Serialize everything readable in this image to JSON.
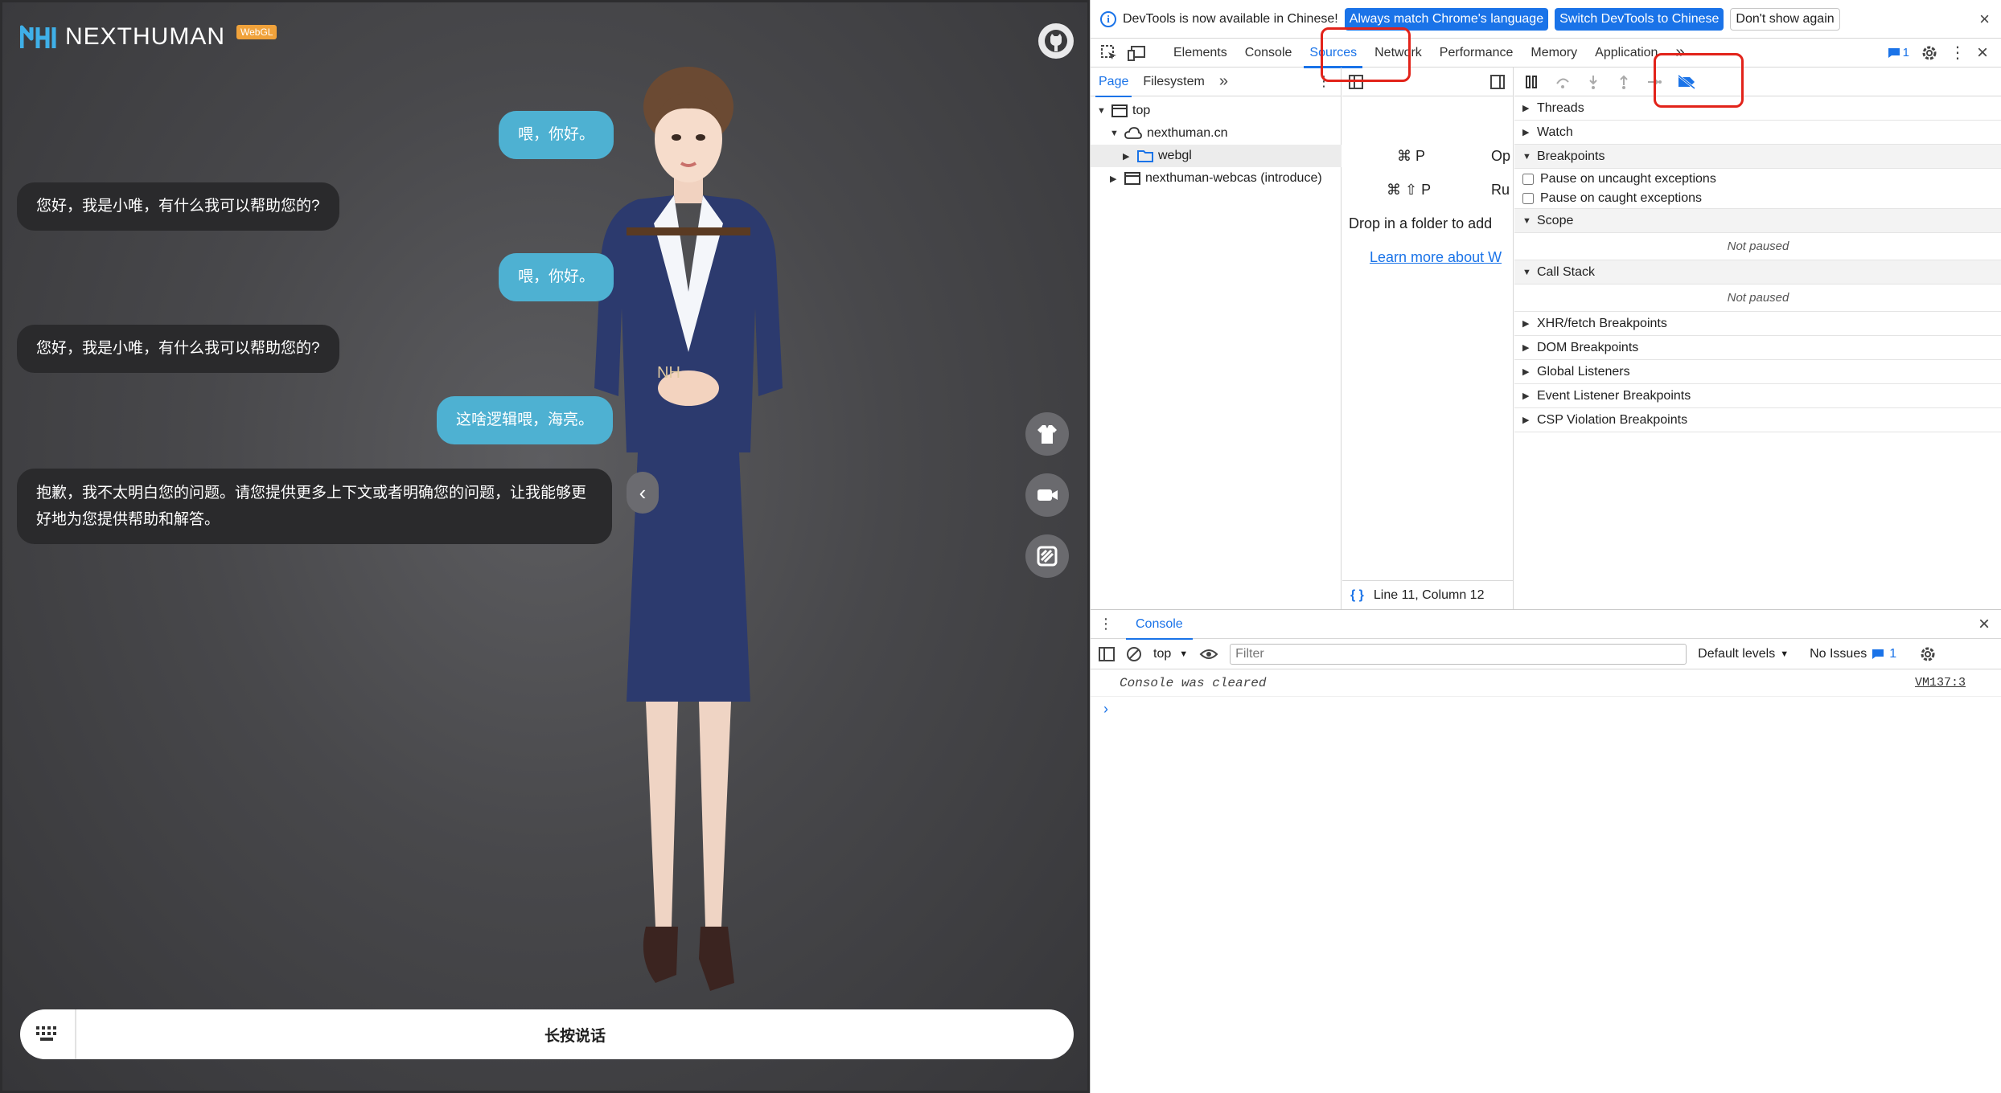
{
  "app": {
    "logo_text": "NEXTHUMAN",
    "logo_badge": "WebGL",
    "messages": [
      {
        "role": "user",
        "text": "喂，你好。"
      },
      {
        "role": "bot",
        "text": "您好，我是小唯，有什么我可以帮助您的?"
      },
      {
        "role": "user",
        "text": "喂，你好。"
      },
      {
        "role": "bot",
        "text": "您好，我是小唯，有什么我可以帮助您的?"
      },
      {
        "role": "user",
        "text": "这啥逻辑喂，海亮。"
      },
      {
        "role": "bot",
        "text": "抱歉，我不太明白您的问题。请您提供更多上下文或者明确您的问题，让我能够更好地为您提供帮助和解答。"
      }
    ],
    "belt_text": "NH",
    "hold_to_talk": "长按说话"
  },
  "devtools": {
    "infobar": {
      "text": "DevTools is now available in Chinese!",
      "btn_match": "Always match Chrome's language",
      "btn_switch": "Switch DevTools to Chinese",
      "btn_dont": "Don't show again"
    },
    "tabs": [
      "Elements",
      "Console",
      "Sources",
      "Network",
      "Performance",
      "Memory",
      "Application"
    ],
    "active_tab": "Sources",
    "issues_count": "1",
    "navigator": {
      "tabs": [
        "Page",
        "Filesystem"
      ],
      "tree": [
        "top",
        "nexthuman.cn",
        "webgl",
        "nexthuman-webcas (introduce)"
      ]
    },
    "editor": {
      "shortcut1_keys": "⌘ P",
      "shortcut1_label": "Op",
      "shortcut2_keys": "⌘ ⇧ P",
      "shortcut2_label": "Ru",
      "drop_text": "Drop in a folder to add",
      "learn_more": "Learn more about W",
      "cursor": "Line 11, Column 12"
    },
    "debugger": {
      "threads": "Threads",
      "watch": "Watch",
      "breakpoints": "Breakpoints",
      "pause_uncaught": "Pause on uncaught exceptions",
      "pause_caught": "Pause on caught exceptions",
      "scope": "Scope",
      "not_paused": "Not paused",
      "call_stack": "Call Stack",
      "xhr": "XHR/fetch Breakpoints",
      "dom": "DOM Breakpoints",
      "global": "Global Listeners",
      "event": "Event Listener Breakpoints",
      "csp": "CSP Violation Breakpoints"
    },
    "console": {
      "tab": "Console",
      "context": "top",
      "filter_placeholder": "Filter",
      "levels": "Default levels",
      "issues": "No Issues",
      "issues_count": "1",
      "message": "Console was cleared",
      "source": "VM137:3"
    }
  },
  "colors": {
    "accent": "#1a73e8",
    "user_bubble": "#4eb1d2",
    "bot_bubble": "#2a2a2c",
    "highlight": "#e2231a"
  }
}
